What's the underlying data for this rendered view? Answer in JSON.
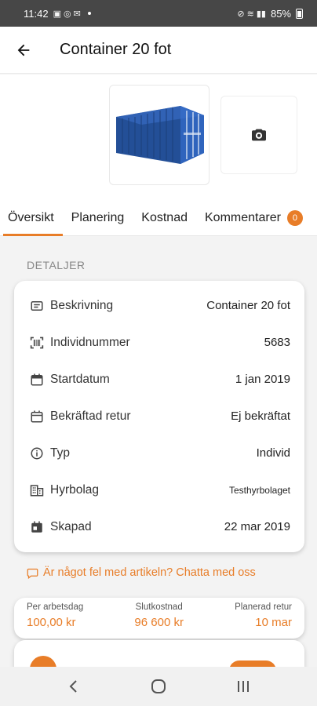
{
  "status_bar": {
    "time": "11:42",
    "battery": "85%",
    "dot": "•"
  },
  "app_bar": {
    "title": "Container 20 fot"
  },
  "tabs": [
    {
      "label": "Översikt",
      "active": true
    },
    {
      "label": "Planering",
      "active": false
    },
    {
      "label": "Kostnad",
      "active": false
    },
    {
      "label": "Kommentarer",
      "active": false,
      "badge": "0"
    }
  ],
  "details": {
    "section_title": "DETALJER",
    "rows": [
      {
        "label": "Beskrivning",
        "value": "Container 20 fot",
        "icon": "description-icon"
      },
      {
        "label": "Individnummer",
        "value": "5683",
        "icon": "barcode-scan-icon"
      },
      {
        "label": "Startdatum",
        "value": "1 jan 2019",
        "icon": "calendar-icon"
      },
      {
        "label": "Bekräftad retur",
        "value": "Ej bekräftat",
        "icon": "calendar-outline-icon"
      },
      {
        "label": "Typ",
        "value": "Individ",
        "icon": "info-icon"
      },
      {
        "label": "Hyrbolag",
        "value": "Testhyrbolaget",
        "icon": "building-icon"
      },
      {
        "label": "Skapad",
        "value": "22 mar 2019",
        "icon": "calendar-filled-icon"
      }
    ]
  },
  "chat": {
    "text": "Är något fel med artikeln? Chatta med oss"
  },
  "summary": {
    "per_day_label": "Per arbetsdag",
    "per_day_value": "100,00 kr",
    "total_label": "Slutkostnad",
    "total_value": "96 600 kr",
    "return_label": "Planerad retur",
    "return_value": "10 mar"
  },
  "colors": {
    "accent": "#e87d28",
    "status_bar": "#474747",
    "container_blue": "#2a5fb0"
  }
}
